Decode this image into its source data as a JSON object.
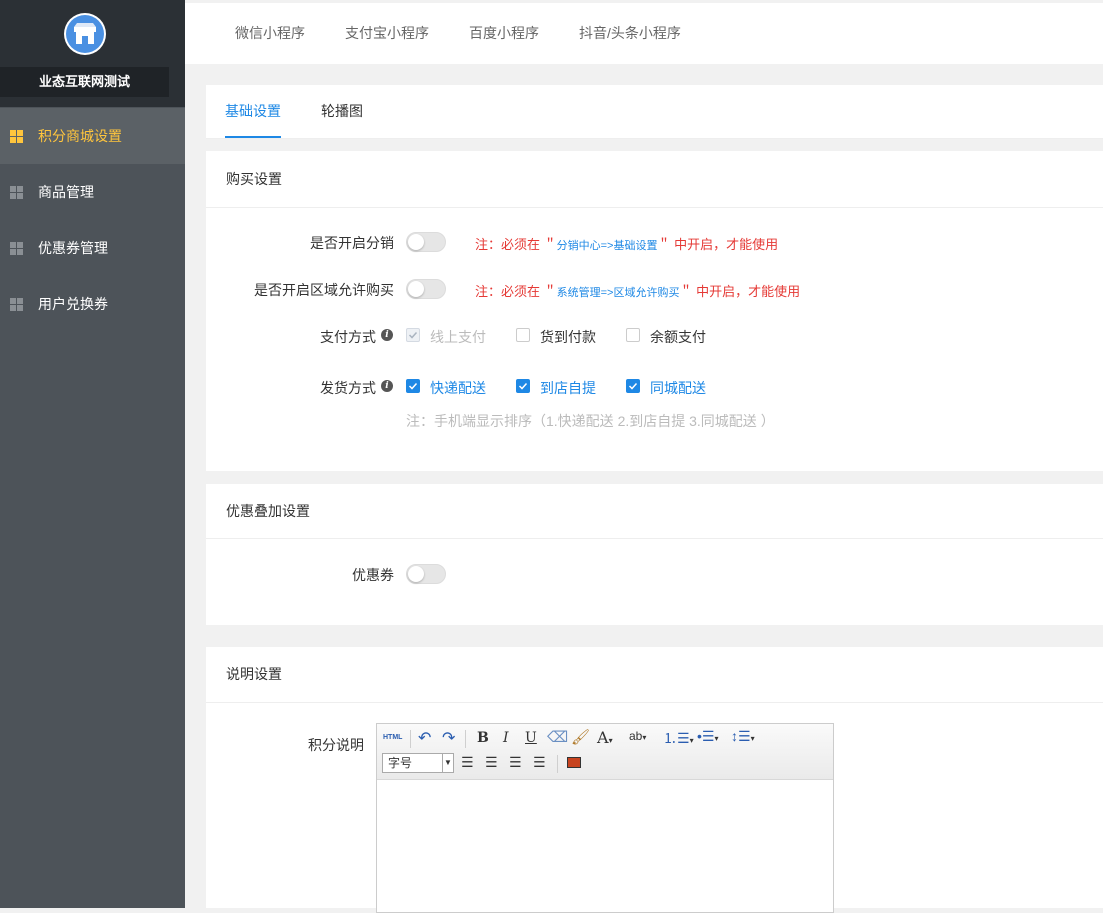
{
  "sidebar": {
    "brand_name": "业态互联网测试",
    "items": [
      {
        "label": "积分商城设置"
      },
      {
        "label": "商品管理"
      },
      {
        "label": "优惠券管理"
      },
      {
        "label": "用户兑换券"
      }
    ]
  },
  "top_tabs": [
    "微信小程序",
    "支付宝小程序",
    "百度小程序",
    "抖音/头条小程序"
  ],
  "sub_tabs": [
    "基础设置",
    "轮播图"
  ],
  "purchase": {
    "title": "购买设置",
    "distribution_label": "是否开启分销",
    "distribution_note_pre": "注：必须在 ＂",
    "distribution_note_link": "分销中心=>基础设置",
    "distribution_note_post": "＂ 中开启，才能使用",
    "region_label": "是否开启区域允许购买",
    "region_note_pre": "注：必须在 ＂",
    "region_note_link": "系统管理=>区域允许购买",
    "region_note_post": "＂ 中开启，才能使用",
    "payment_label": "支付方式",
    "payment_options": [
      "线上支付",
      "货到付款",
      "余额支付"
    ],
    "delivery_label": "发货方式",
    "delivery_options": [
      "快递配送",
      "到店自提",
      "同城配送"
    ],
    "delivery_hint": "注：手机端显示排序（1.快递配送 2.到店自提 3.同城配送 ）"
  },
  "discount": {
    "title": "优惠叠加设置",
    "coupon_label": "优惠券"
  },
  "description": {
    "title": "说明设置",
    "field_label": "积分说明",
    "html_btn": "HTML",
    "font_size_placeholder": "字号"
  },
  "colors": {
    "accent": "#1e88e5",
    "active_nav": "#ffc53d",
    "warning": "#e53935",
    "sidebar_bg": "#4d5359"
  }
}
